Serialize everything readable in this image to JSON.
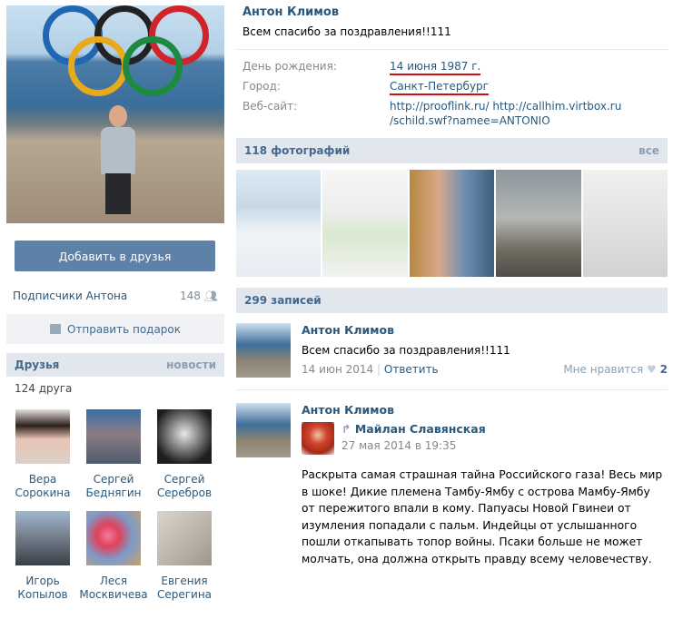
{
  "profile": {
    "name": "Антон Климов",
    "status": "Всем спасибо за поздравления!!111",
    "info": [
      {
        "key": "День рождения:",
        "value": "14 июня 1987 г."
      },
      {
        "key": "Город:",
        "value": "Санкт-Петербург"
      },
      {
        "key": "Веб-сайт:",
        "value": "http://prooflink.ru/  http://callhim.virtbox.ru /schild.swf?namee=ANTONIO"
      }
    ]
  },
  "left": {
    "add_friend_label": "Добавить в друзья",
    "subscribers_label": "Подписчики Антона",
    "subscribers_count": "148",
    "gift_label": "Отправить подарок",
    "friends_title": "Друзья",
    "friends_news_link": "новости",
    "friends_count_label": "124 друга",
    "friends": [
      {
        "name": "Вера Сорокина"
      },
      {
        "name": "Сергей Беднягин"
      },
      {
        "name": "Сергей Серебров"
      },
      {
        "name": "Игорь Копылов"
      },
      {
        "name": "Леся Москвичева"
      },
      {
        "name": "Евгения Серегина"
      }
    ]
  },
  "photos": {
    "title": "118 фотографий",
    "all_link": "все"
  },
  "wall": {
    "title": "299 записей",
    "posts": [
      {
        "author": "Антон Климов",
        "text": "Всем спасибо за поздравления!!111",
        "date": "14 июн 2014",
        "reply_label": "Ответить",
        "like_label": "Мне нравится",
        "like_count": "2"
      },
      {
        "author": "Антон Климов",
        "repost_author": "Майлан Славянская",
        "repost_date": "27 мая 2014 в 19:35",
        "repost_text": "Раскрыта самая страшная тайна Российского газа! Весь мир в шоке! Дикие племена Тамбу-Ямбу с острова Мамбу-Ямбу от пережитого впали в кому. Папуасы Новой Гвинеи от изумления попадали с пальм. Индейцы от услышанного пошли откапывать топор войны. Псаки больше не может молчать, она должна открыть правду всему человечеству."
      }
    ]
  },
  "colors": {
    "accent": "#2b587a",
    "button": "#5e81a8",
    "header_bg": "#e1e7ed",
    "underline": "#d10d0d"
  }
}
